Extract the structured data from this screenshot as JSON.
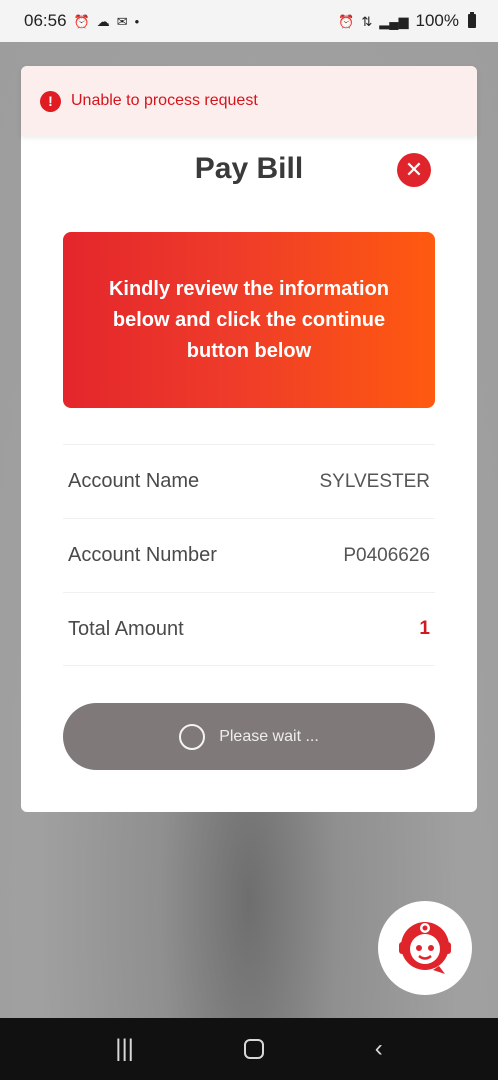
{
  "status_bar": {
    "time": "06:56",
    "battery": "100%"
  },
  "toast": {
    "message": "Unable to process request",
    "icon": "alert-circle-icon"
  },
  "modal": {
    "title": "Pay Bill",
    "close_icon": "close-icon",
    "banner_text": "Kindly review the information below and click the continue button below",
    "rows": [
      {
        "label": "Account Name",
        "value": "SYLVESTER"
      },
      {
        "label": "Account Number",
        "value": "P0406626"
      },
      {
        "label": "Total Amount",
        "value": "1"
      }
    ],
    "wait_button": "Please wait ..."
  },
  "chat": {
    "icon": "chatbot-icon"
  },
  "nav": {
    "recents_icon": "recents-icon",
    "home_icon": "home-icon",
    "back_icon": "back-icon"
  },
  "colors": {
    "accent_red": "#e0242b",
    "banner_start": "#e4262c",
    "banner_end": "#ff5a10",
    "wait_button": "#7f7a79"
  }
}
